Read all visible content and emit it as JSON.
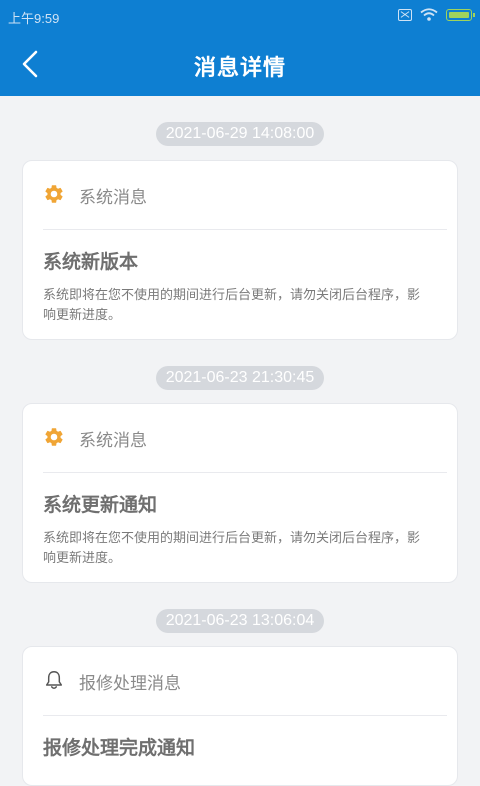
{
  "status_bar": {
    "time": "上午9:59",
    "icons": [
      "no-sim-icon",
      "wifi-icon",
      "battery-charging-icon"
    ],
    "color": "#0e7fd2"
  },
  "header": {
    "title": "消息详情",
    "back_icon": "chevron-left-icon",
    "background": "#0e7fd2"
  },
  "messages": [
    {
      "time": "2021-06-29 14:08:00",
      "category": "系统消息",
      "category_icon": "gear-icon",
      "title": "系统新版本",
      "body": "系统即将在您不使用的期间进行后台更新，请勿关闭后台程序，影响更新进度。"
    },
    {
      "time": "2021-06-23 21:30:45",
      "category": "系统消息",
      "category_icon": "gear-icon",
      "title": "系统更新通知",
      "body": "系统即将在您不使用的期间进行后台更新，请勿关闭后台程序，影响更新进度。"
    },
    {
      "time": "2021-06-23 13:06:04",
      "category": "报修处理消息",
      "category_icon": "bell-icon",
      "title": "报修处理完成通知"
    }
  ],
  "colors": {
    "gear_icon": "#f0a535",
    "bell_icon": "#555555",
    "page_background": "#f2f3f5"
  }
}
